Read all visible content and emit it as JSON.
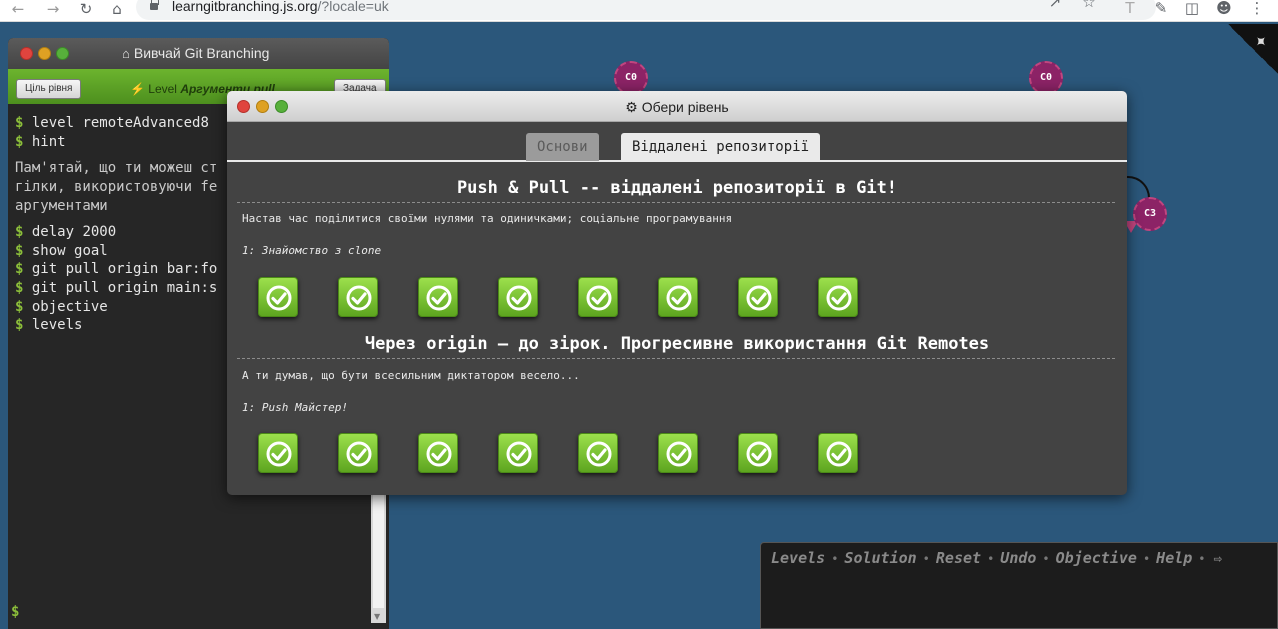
{
  "browser": {
    "url_host": "learngitbranching.js.org",
    "url_path": "/?locale=uk"
  },
  "terminal": {
    "title": "Вивчай Git Branching",
    "goal_button": "Ціль рівня",
    "level_prefix": "Level",
    "level_name": "Аргументи pull",
    "task_button": "Задача",
    "lines1": [
      "level remoteAdvanced8",
      "hint"
    ],
    "info_lines": [
      "Пам'ятай, що ти можеш ст",
      "гілки, використовуючи fe",
      "аргументами"
    ],
    "lines2": [
      "delay 2000",
      "show goal",
      "git pull origin bar:fo",
      "git pull origin main:s",
      "objective",
      "levels"
    ],
    "prompt": "$"
  },
  "commits": [
    {
      "label": "C0"
    },
    {
      "label": "C0"
    },
    {
      "label": "C3"
    }
  ],
  "command_bar": {
    "items": [
      "Levels",
      "Solution",
      "Reset",
      "Undo",
      "Objective",
      "Help"
    ],
    "separator": "•"
  },
  "modal": {
    "title": "Обери рівень",
    "tabs": [
      {
        "label": "Основи",
        "active": false
      },
      {
        "label": "Віддалені репозиторії",
        "active": true
      }
    ],
    "sequences": [
      {
        "title": "Push & Pull -- віддалені репозиторії в Git!",
        "about": "Настав час поділитися своїми нулями та одиничками; соціальне програмування",
        "level_label": "1: Знайомство з clone",
        "levels_solved": [
          true,
          true,
          true,
          true,
          true,
          true,
          true,
          true
        ]
      },
      {
        "title": "Через origin – до зірок. Прогресивне використання Git Remotes",
        "about": "А ти думав, що бути всесильним диктатором весело...",
        "level_label": "1: Push Майстер!",
        "levels_solved": [
          true,
          true,
          true,
          true,
          true,
          true,
          true,
          true
        ]
      }
    ]
  },
  "colors": {
    "background": "#2b577b",
    "level_solved": "#7cc436",
    "commit": "#8c2366"
  }
}
